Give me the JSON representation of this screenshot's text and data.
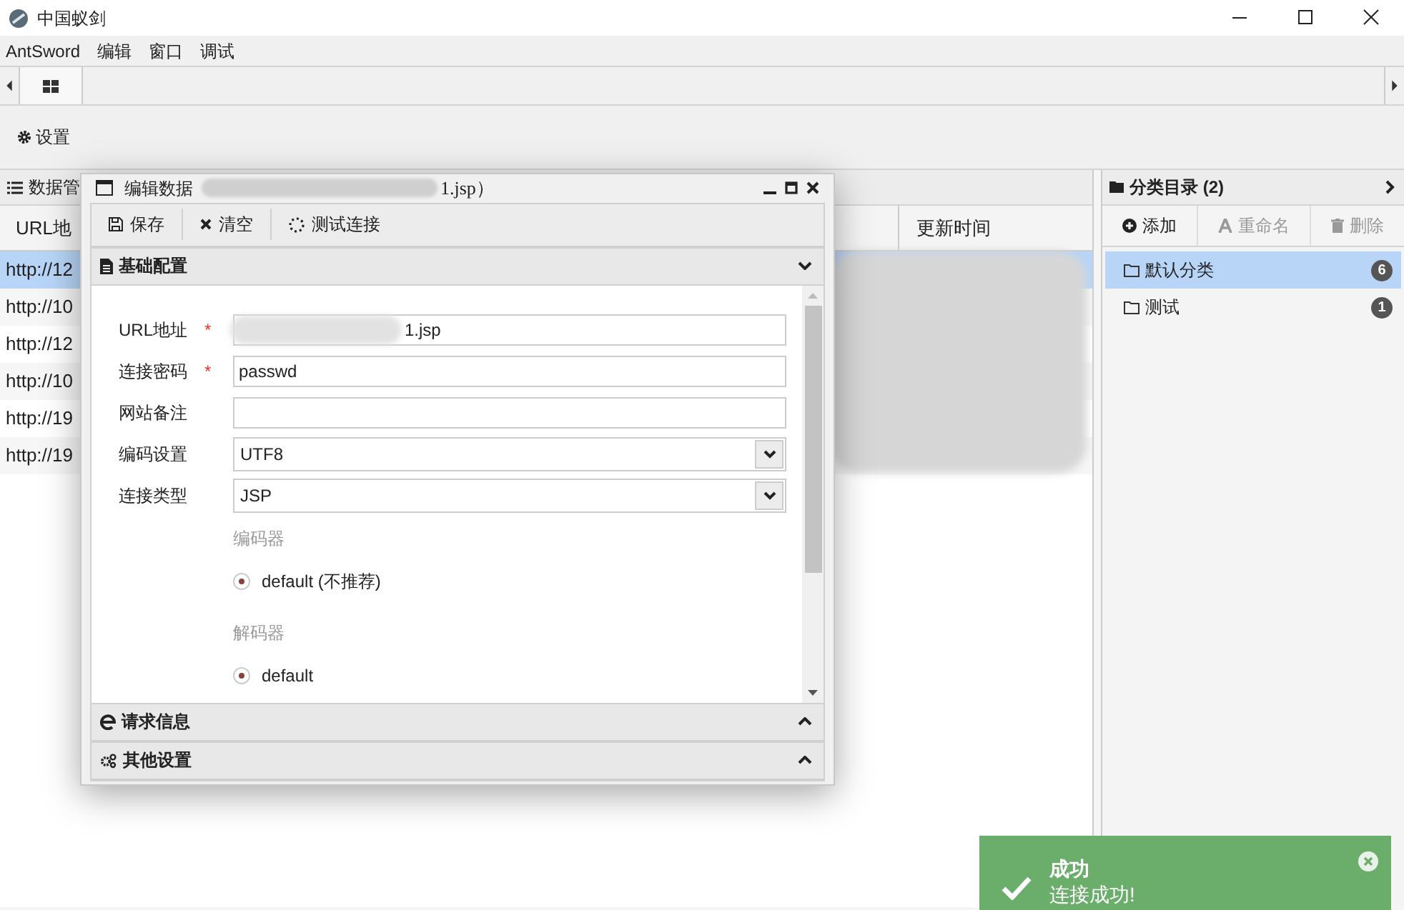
{
  "window": {
    "title": "中国蚁剑"
  },
  "menu": [
    "AntSword",
    "编辑",
    "窗口",
    "调试"
  ],
  "toolbar": {
    "settings": "设置"
  },
  "data_panel": {
    "title": "数据管",
    "columns": [
      {
        "label": "URL地"
      },
      {
        "label": "更新时间"
      }
    ],
    "rows": [
      {
        "url": "http://12",
        "selected": true
      },
      {
        "url": "http://10",
        "selected": false
      },
      {
        "url": "http://12",
        "selected": false
      },
      {
        "url": "http://10",
        "selected": false
      },
      {
        "url": "http://19",
        "selected": false
      },
      {
        "url": "http://19",
        "selected": false
      }
    ]
  },
  "category_panel": {
    "title": "分类目录 (2)",
    "actions": [
      {
        "label": "添加",
        "disabled": false
      },
      {
        "label": "重命名",
        "disabled": true
      },
      {
        "label": "删除",
        "disabled": true
      }
    ],
    "items": [
      {
        "label": "默认分类",
        "count": "6",
        "selected": true
      },
      {
        "label": "测试",
        "count": "1",
        "selected": false
      }
    ]
  },
  "dialog": {
    "title": "编辑数据",
    "title_suffix": "1.jsp）",
    "actions": [
      "保存",
      "清空",
      "测试连接"
    ],
    "sections": [
      {
        "label": "基础配置",
        "expanded": true
      },
      {
        "label": "请求信息",
        "expanded": false
      },
      {
        "label": "其他设置",
        "expanded": false
      }
    ],
    "fields": [
      {
        "kind": "text",
        "label": "URL地址",
        "required_mark": "*",
        "value": "1.jsp"
      },
      {
        "kind": "text",
        "label": "连接密码",
        "required_mark": "*",
        "value": "passwd"
      },
      {
        "kind": "text",
        "label": "网站备注"
      },
      {
        "kind": "select",
        "label": "编码设置",
        "value": "UTF8"
      },
      {
        "kind": "select",
        "label": "连接类型",
        "value": "JSP"
      }
    ],
    "encoder": {
      "label": "编码器",
      "options": [
        {
          "label": "default (不推荐)",
          "selected": true
        }
      ]
    },
    "decoder": {
      "label": "解码器",
      "options": [
        {
          "label": "default",
          "selected": true
        }
      ]
    }
  },
  "toast": {
    "title": "成功",
    "message": "连接成功!"
  }
}
